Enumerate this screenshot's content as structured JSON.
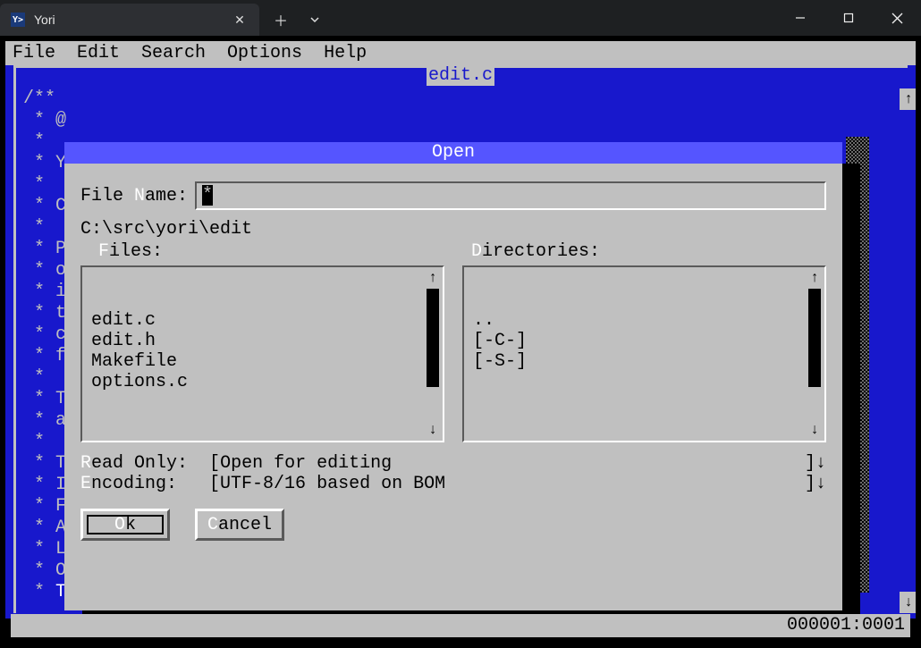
{
  "window": {
    "tab_title": "Yori",
    "app_icon_text": "Y>"
  },
  "menubar": {
    "items": [
      "File",
      "Edit",
      "Search",
      "Options",
      "Help"
    ]
  },
  "editor": {
    "title": "edit.c",
    "left_fragments": [
      "/**",
      " * @",
      " *",
      " * Y",
      " *",
      " * C",
      " *",
      " * P",
      " * o",
      " * i",
      " * t",
      " * c",
      " * f",
      " *",
      " * T",
      " * a",
      " *",
      " * T",
      " * I",
      " * F",
      " * A",
      " * L",
      " * O",
      " * THE"
    ]
  },
  "dialog": {
    "title": "Open",
    "filename_label_pre": "File ",
    "filename_label_hot": "N",
    "filename_label_post": "ame:",
    "filename_value": "*",
    "path": "C:\\src\\yori\\edit",
    "files_label_hot": "F",
    "files_label_post": "iles:",
    "dirs_label_hot": "D",
    "dirs_label_post": "irectories:",
    "files": [
      "edit.c",
      "edit.h",
      "Makefile",
      "options.c"
    ],
    "directories": [
      "..",
      "[-C-]",
      "[-S-]"
    ],
    "readonly_label_hot": "R",
    "readonly_label_post": "ead Only:",
    "readonly_value": "Open for editing",
    "encoding_label_hot": "E",
    "encoding_label_post": "ncoding:",
    "encoding_value": "UTF-8/16 based on BOM",
    "ok_hot": "O",
    "ok_post": "k",
    "cancel_hot": "C",
    "cancel_post": "ancel"
  },
  "status": {
    "position": "000001:0001"
  }
}
